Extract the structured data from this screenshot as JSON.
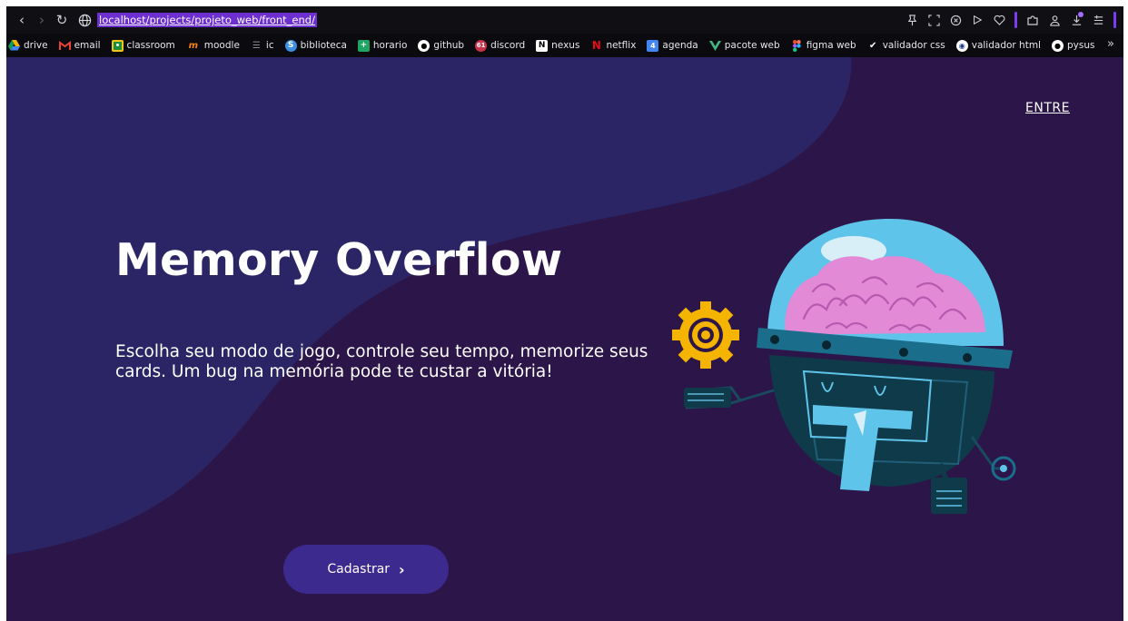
{
  "browser": {
    "url": "localhost/projects/projeto_web/front_end/",
    "bookmarks": [
      {
        "label": "drive",
        "icon": "drive-icon",
        "color": "#f4b400"
      },
      {
        "label": "email",
        "icon": "gmail-icon",
        "color": "#ea4335"
      },
      {
        "label": "classroom",
        "icon": "classroom-icon",
        "color": "#f5c518"
      },
      {
        "label": "moodle",
        "icon": "moodle-icon",
        "color": "#f98012"
      },
      {
        "label": "ic",
        "icon": "list-icon",
        "color": "#8a8a94"
      },
      {
        "label": "biblioteca",
        "icon": "library-icon",
        "color": "#3b8fe0"
      },
      {
        "label": "horario",
        "icon": "sheets-icon",
        "color": "#1fa463"
      },
      {
        "label": "github",
        "icon": "github-icon",
        "color": "#ffffff"
      },
      {
        "label": "discord",
        "icon": "discord-icon",
        "color": "#5865f2"
      },
      {
        "label": "nexus",
        "icon": "notion-icon",
        "color": "#ffffff"
      },
      {
        "label": "netflix",
        "icon": "netflix-icon",
        "color": "#e50914"
      },
      {
        "label": "agenda",
        "icon": "calendar-icon",
        "color": "#4285f4"
      },
      {
        "label": "pacote web",
        "icon": "vue-icon",
        "color": "#42b883"
      },
      {
        "label": "figma web",
        "icon": "figma-icon",
        "color": "#f24e1e"
      },
      {
        "label": "validador css",
        "icon": "css-validator-icon",
        "color": "#ffffff"
      },
      {
        "label": "validador html",
        "icon": "html-validator-icon",
        "color": "#ffffff"
      },
      {
        "label": "pysus",
        "icon": "github-icon",
        "color": "#ffffff"
      }
    ],
    "discord_badge": "61"
  },
  "page": {
    "nav_link": "ENTRE",
    "title": "Memory Overflow",
    "description": "Escolha seu modo de jogo, controle seu tempo, memorize seus cards. Um bug na memória pode te custar a vitória!",
    "cta_label": "Cadastrar",
    "colors": {
      "background": "#2c1548",
      "blob": "#2b2566",
      "button": "#3c2a8f",
      "text": "#ffffff"
    }
  }
}
